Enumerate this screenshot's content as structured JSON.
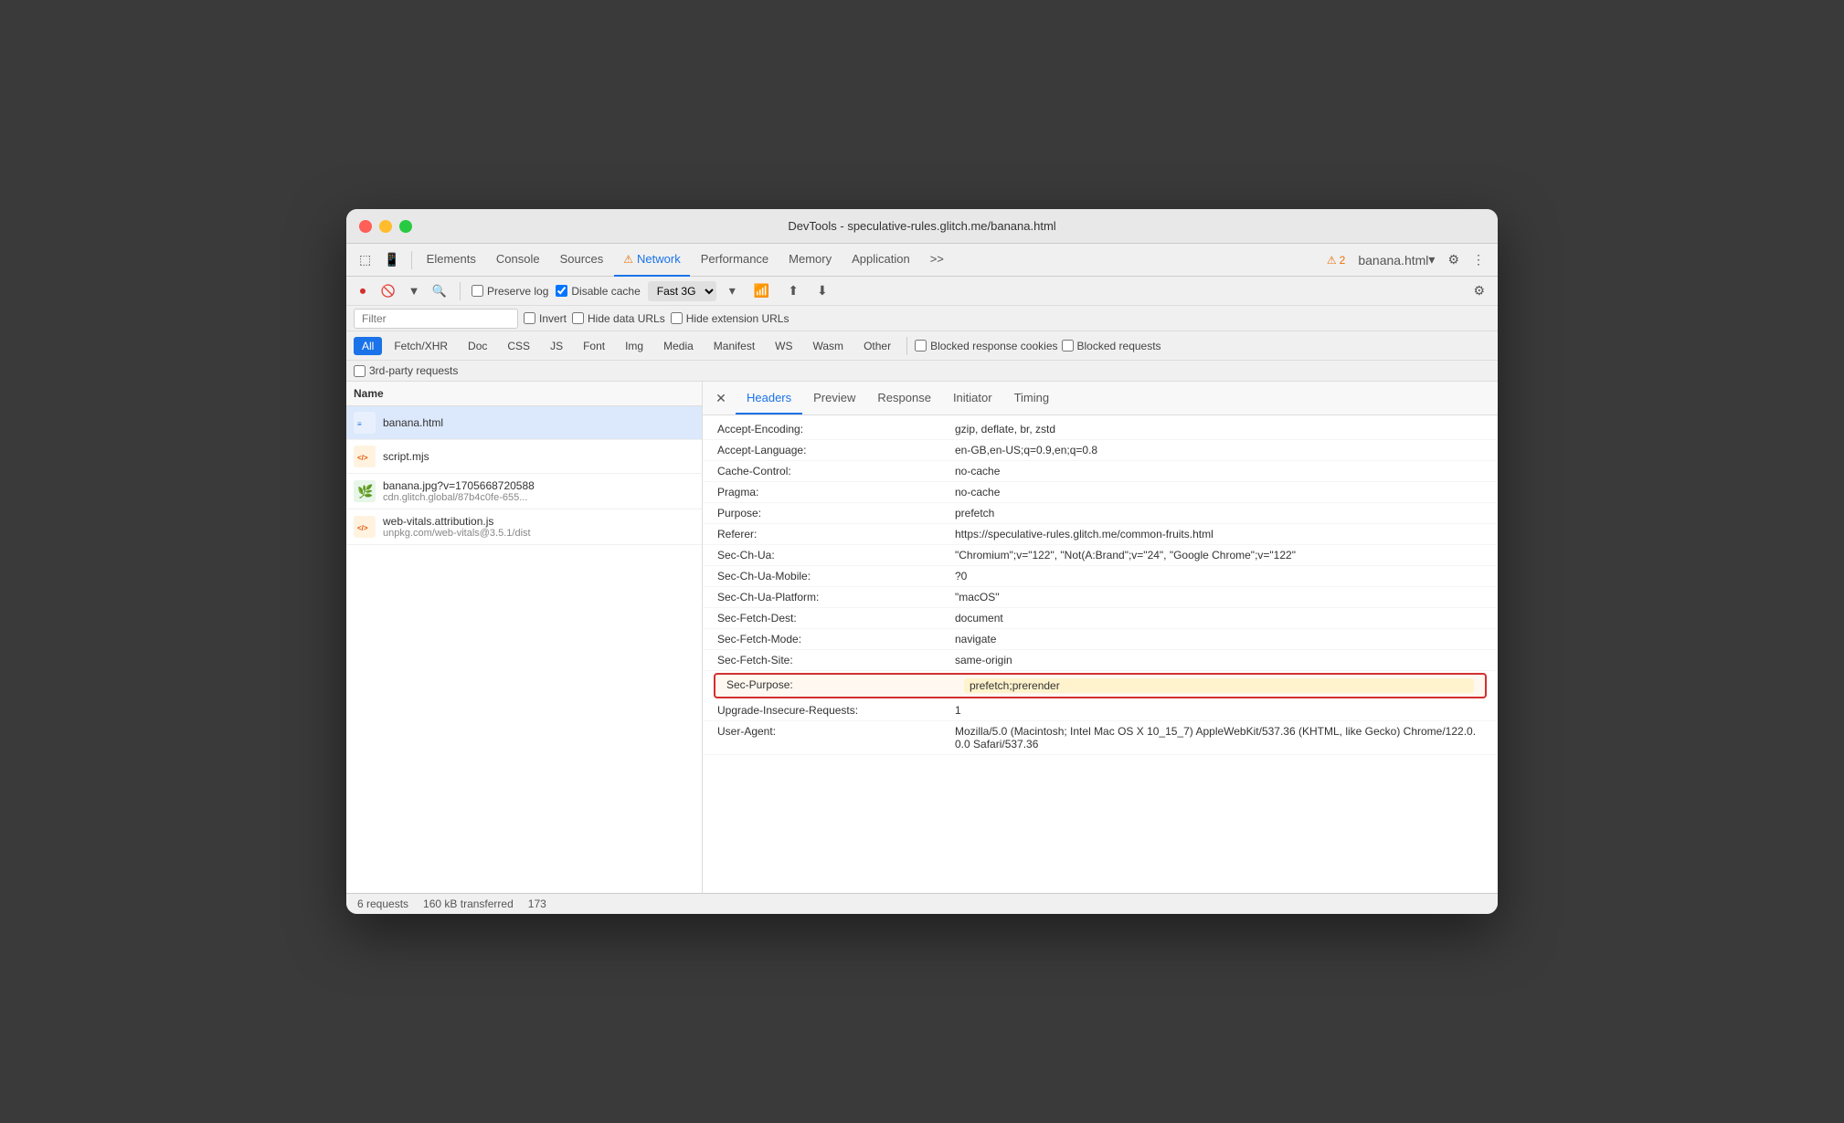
{
  "window": {
    "title": "DevTools - speculative-rules.glitch.me/banana.html"
  },
  "titlebar_buttons": {
    "close": "×",
    "minimize": "−",
    "maximize": "+"
  },
  "tabs": [
    {
      "label": "Elements",
      "active": false
    },
    {
      "label": "Console",
      "active": false
    },
    {
      "label": "Sources",
      "active": false
    },
    {
      "label": "⚠ Network",
      "active": true
    },
    {
      "label": "Performance",
      "active": false
    },
    {
      "label": "Memory",
      "active": false
    },
    {
      "label": "Application",
      "active": false
    },
    {
      "label": "»",
      "active": false
    }
  ],
  "toolbar": {
    "warning_count": "2",
    "filename": "banana.html",
    "settings_icon": "⚙",
    "more_icon": "⋮"
  },
  "controls": {
    "preserve_log": "Preserve log",
    "disable_cache": "Disable cache",
    "throttle": "Fast 3G"
  },
  "filter": {
    "placeholder": "Filter",
    "invert": "Invert",
    "hide_data_urls": "Hide data URLs",
    "hide_extension_urls": "Hide extension URLs"
  },
  "filter_buttons": [
    {
      "label": "All",
      "active": true
    },
    {
      "label": "Fetch/XHR",
      "active": false
    },
    {
      "label": "Doc",
      "active": false
    },
    {
      "label": "CSS",
      "active": false
    },
    {
      "label": "JS",
      "active": false
    },
    {
      "label": "Font",
      "active": false
    },
    {
      "label": "Img",
      "active": false
    },
    {
      "label": "Media",
      "active": false
    },
    {
      "label": "Manifest",
      "active": false
    },
    {
      "label": "WS",
      "active": false
    },
    {
      "label": "Wasm",
      "active": false
    },
    {
      "label": "Other",
      "active": false
    }
  ],
  "checkboxes": {
    "blocked_response_cookies": "Blocked response cookies",
    "blocked_requests": "Blocked requests",
    "third_party": "3rd-party requests"
  },
  "file_list": {
    "header": "Name",
    "files": [
      {
        "name": "banana.html",
        "url": "",
        "icon_type": "html",
        "selected": true
      },
      {
        "name": "script.mjs",
        "url": "",
        "icon_type": "js",
        "selected": false
      },
      {
        "name": "banana.jpg?v=1705668720588",
        "url": "cdn.glitch.global/87b4c0fe-655...",
        "icon_type": "img",
        "selected": false
      },
      {
        "name": "web-vitals.attribution.js",
        "url": "unpkg.com/web-vitals@3.5.1/dist",
        "icon_type": "js",
        "selected": false
      }
    ]
  },
  "headers_panel": {
    "tabs": [
      "Headers",
      "Preview",
      "Response",
      "Initiator",
      "Timing"
    ],
    "active_tab": "Headers",
    "headers": [
      {
        "name": "Accept-Encoding:",
        "value": "gzip, deflate, br, zstd",
        "highlighted": false
      },
      {
        "name": "Accept-Language:",
        "value": "en-GB,en-US;q=0.9,en;q=0.8",
        "highlighted": false
      },
      {
        "name": "Cache-Control:",
        "value": "no-cache",
        "highlighted": false
      },
      {
        "name": "Pragma:",
        "value": "no-cache",
        "highlighted": false
      },
      {
        "name": "Purpose:",
        "value": "prefetch",
        "highlighted": false
      },
      {
        "name": "Referer:",
        "value": "https://speculative-rules.glitch.me/common-fruits.html",
        "highlighted": false
      },
      {
        "name": "Sec-Ch-Ua:",
        "value": "\"Chromium\";v=\"122\", \"Not(A:Brand\";v=\"24\", \"Google Chrome\";v=\"122\"",
        "highlighted": false
      },
      {
        "name": "Sec-Ch-Ua-Mobile:",
        "value": "?0",
        "highlighted": false
      },
      {
        "name": "Sec-Ch-Ua-Platform:",
        "value": "\"macOS\"",
        "highlighted": false
      },
      {
        "name": "Sec-Fetch-Dest:",
        "value": "document",
        "highlighted": false
      },
      {
        "name": "Sec-Fetch-Mode:",
        "value": "navigate",
        "highlighted": false
      },
      {
        "name": "Sec-Fetch-Site:",
        "value": "same-origin",
        "highlighted": false
      },
      {
        "name": "Sec-Purpose:",
        "value": "prefetch;prerender",
        "highlighted": true
      },
      {
        "name": "Upgrade-Insecure-Requests:",
        "value": "1",
        "highlighted": false
      },
      {
        "name": "User-Agent:",
        "value": "Mozilla/5.0 (Macintosh; Intel Mac OS X 10_15_7) AppleWebKit/537.36 (KHTML, like Gecko) Chrome/122.0.0.0 Safari/537.36",
        "highlighted": false
      }
    ]
  },
  "status_bar": {
    "requests": "6 requests",
    "transferred": "160 kB transferred",
    "size": "173"
  }
}
